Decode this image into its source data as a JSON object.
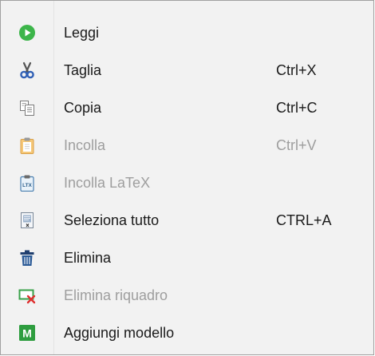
{
  "menu": {
    "items": [
      {
        "label": "Leggi",
        "shortcut": "",
        "icon": "play-icon",
        "enabled": true
      },
      {
        "label": "Taglia",
        "shortcut": "Ctrl+X",
        "icon": "scissors-icon",
        "enabled": true
      },
      {
        "label": "Copia",
        "shortcut": "Ctrl+C",
        "icon": "copy-icon",
        "enabled": true
      },
      {
        "label": "Incolla",
        "shortcut": "Ctrl+V",
        "icon": "clipboard-icon",
        "enabled": false
      },
      {
        "label": "Incolla LaTeX",
        "shortcut": "",
        "icon": "clipboard-latex-icon",
        "icon_text": "LTX",
        "enabled": false
      },
      {
        "label": "Seleziona tutto",
        "shortcut": "CTRL+A",
        "icon": "select-all-icon",
        "enabled": true
      },
      {
        "label": "Elimina",
        "shortcut": "",
        "icon": "trash-icon",
        "enabled": true
      },
      {
        "label": "Elimina riquadro",
        "shortcut": "",
        "icon": "delete-frame-icon",
        "enabled": false
      },
      {
        "label": "Aggiungi modello",
        "shortcut": "",
        "icon": "add-template-icon",
        "icon_text": "M",
        "enabled": true
      }
    ]
  },
  "colors": {
    "menu_background": "#f2f2f2",
    "text": "#1a1a1a",
    "disabled_text": "#9e9e9e",
    "play_green": "#3cb54a",
    "scissors_blue": "#2f5fb5",
    "template_green": "#2e9d3f",
    "delete_red": "#e03030"
  }
}
